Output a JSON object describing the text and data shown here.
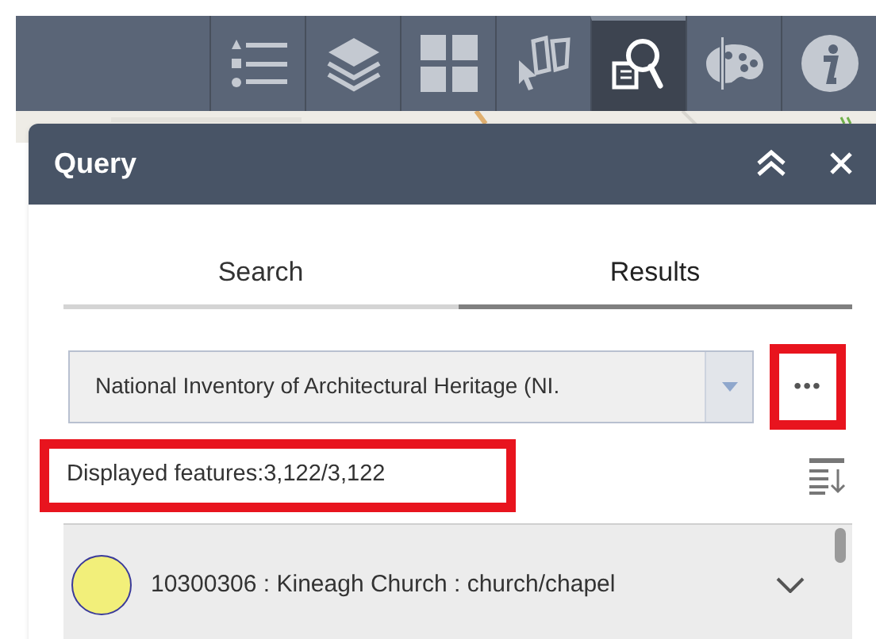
{
  "toolbar": {
    "buttons": [
      {
        "kind": "legend",
        "selected": false
      },
      {
        "kind": "layers",
        "selected": false
      },
      {
        "kind": "grid",
        "selected": false
      },
      {
        "kind": "select",
        "selected": false
      },
      {
        "kind": "query",
        "selected": true
      },
      {
        "kind": "palette",
        "selected": false
      },
      {
        "kind": "info",
        "selected": false
      }
    ]
  },
  "panel": {
    "title": "Query",
    "tabs": [
      {
        "label": "Search",
        "selected": false
      },
      {
        "label": "Results",
        "selected": true
      }
    ],
    "layer_select": {
      "value": "National Inventory of Architectural Heritage (NI."
    },
    "more_button": {
      "label": "•••",
      "highlighted": true
    },
    "feature_count": {
      "text": "Displayed features:3,122/3,122",
      "highlighted": true
    },
    "results": [
      {
        "label": "10300306 : Kineagh Church : church/chapel",
        "color": "#f2ef7a",
        "expanded": false
      }
    ]
  }
}
